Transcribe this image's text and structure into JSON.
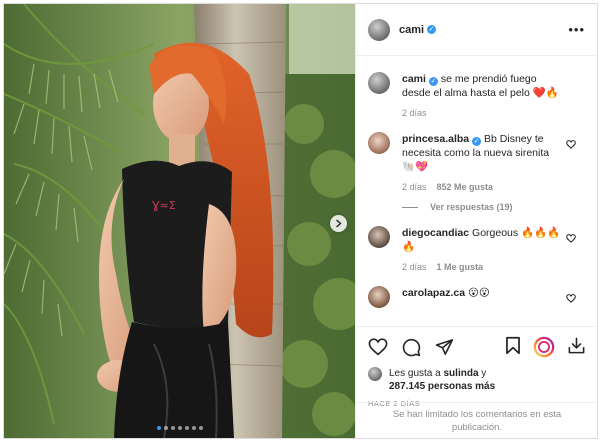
{
  "post": {
    "author": "cami",
    "time_ago": "HACE 2 DÍAS"
  },
  "photo": {
    "slide_count": 7,
    "active_slide": 0,
    "shirt_print": "Ɣ≈Ʃ"
  },
  "comments": [
    {
      "user": "cami",
      "verified": true,
      "text": "se me prendió fuego desde el alma hasta el pelo ❤️🔥",
      "time": "2 días",
      "likes": "",
      "avatar": "a1",
      "has_heart": false
    },
    {
      "user": "princesa.alba",
      "verified": true,
      "text": "Bb Disney te necesita como la nueva sirenita 🐚💖",
      "time": "2 días",
      "likes": "852 Me gusta",
      "avatar": "a2",
      "has_heart": true,
      "replies": "Ver respuestas (19)"
    },
    {
      "user": "diegocandiac",
      "verified": false,
      "text": "Gorgeous 🔥🔥🔥🔥",
      "time": "2 días",
      "likes": "1 Me gusta",
      "avatar": "a3",
      "has_heart": true
    },
    {
      "user": "carolapaz.ca",
      "verified": false,
      "text": "😮😮",
      "time": "",
      "likes": "",
      "avatar": "a4",
      "has_heart": true
    }
  ],
  "likes": {
    "prefix": "Les gusta a",
    "user": "sulinda",
    "joiner": "y",
    "count": "287.145 personas más"
  },
  "footer": {
    "limited_notice": "Se han limitado los comentarios en esta publicación."
  },
  "colors": {
    "verified": "#3897f0",
    "hair": "#d8561f",
    "muted": "#8e8e8e"
  }
}
